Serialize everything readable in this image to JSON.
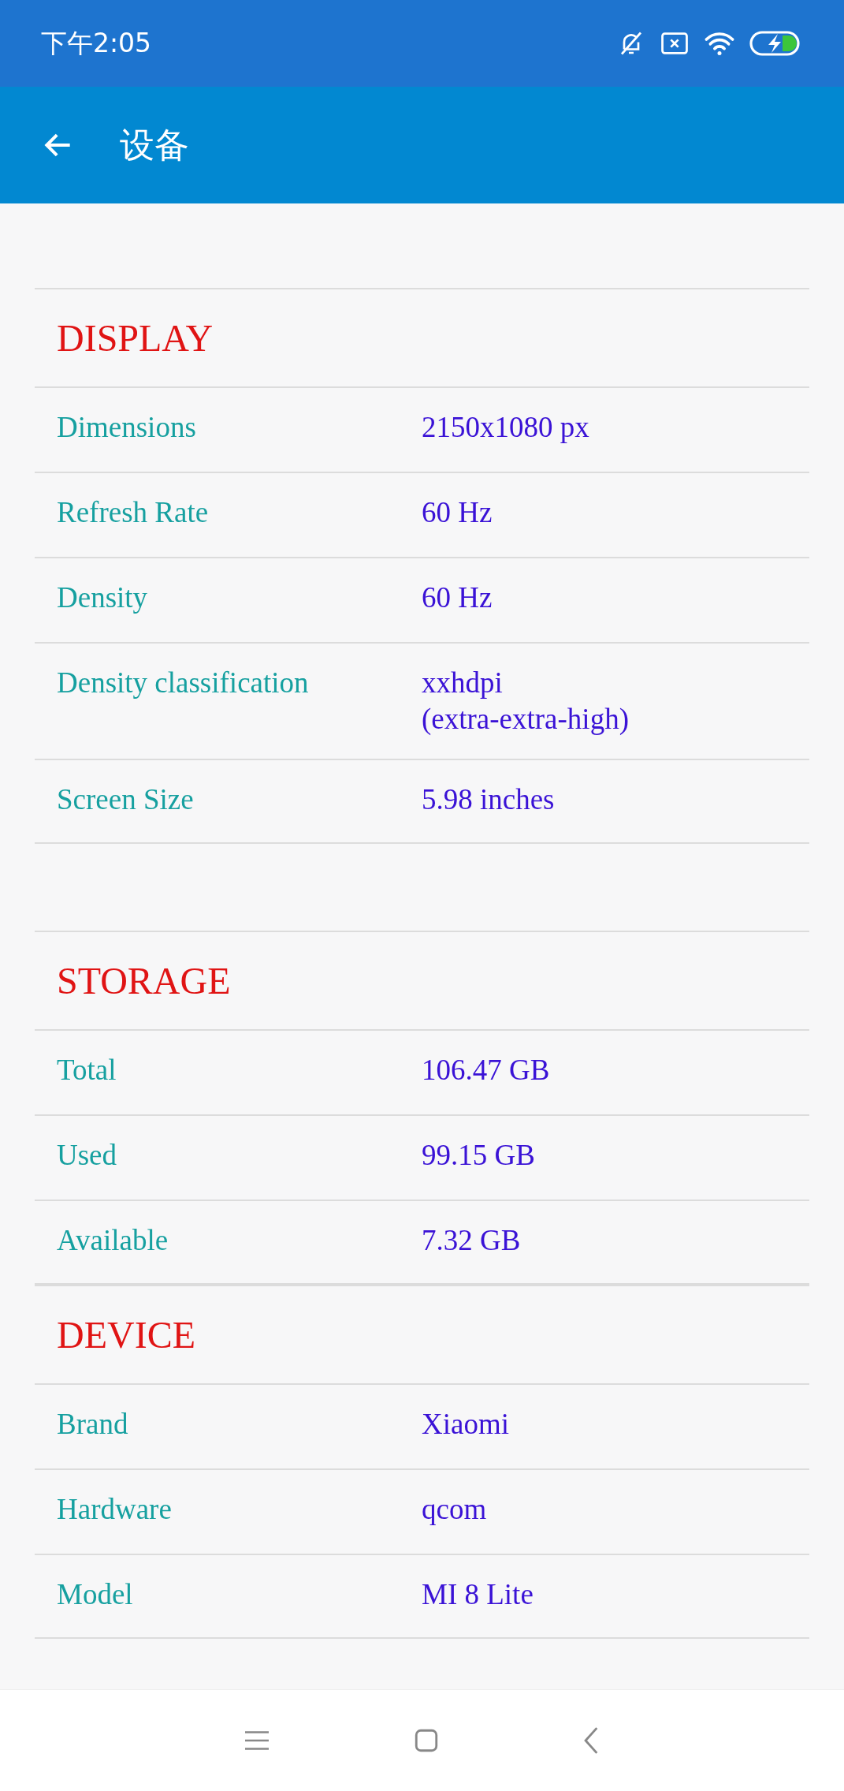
{
  "status_bar": {
    "time": "下午2:05"
  },
  "app_bar": {
    "title": "设备"
  },
  "groups": [
    {
      "sections": [
        {
          "title": "DISPLAY",
          "rows": [
            {
              "label": "Dimensions",
              "value": "2150x1080 px"
            },
            {
              "label": "Refresh Rate",
              "value": "60 Hz"
            },
            {
              "label": "Density",
              "value": "60 Hz"
            },
            {
              "label": "Density classification",
              "value": "xxhdpi\n(extra-extra-high)"
            },
            {
              "label": "Screen Size",
              "value": "5.98 inches"
            }
          ]
        }
      ]
    },
    {
      "sections": [
        {
          "title": "STORAGE",
          "rows": [
            {
              "label": "Total",
              "value": "106.47 GB"
            },
            {
              "label": "Used",
              "value": "99.15 GB"
            },
            {
              "label": "Available",
              "value": "7.32 GB"
            }
          ]
        },
        {
          "title": "DEVICE",
          "rows": [
            {
              "label": "Brand",
              "value": "Xiaomi"
            },
            {
              "label": "Hardware",
              "value": "qcom"
            },
            {
              "label": "Model",
              "value": "MI 8 Lite"
            }
          ]
        }
      ]
    }
  ]
}
